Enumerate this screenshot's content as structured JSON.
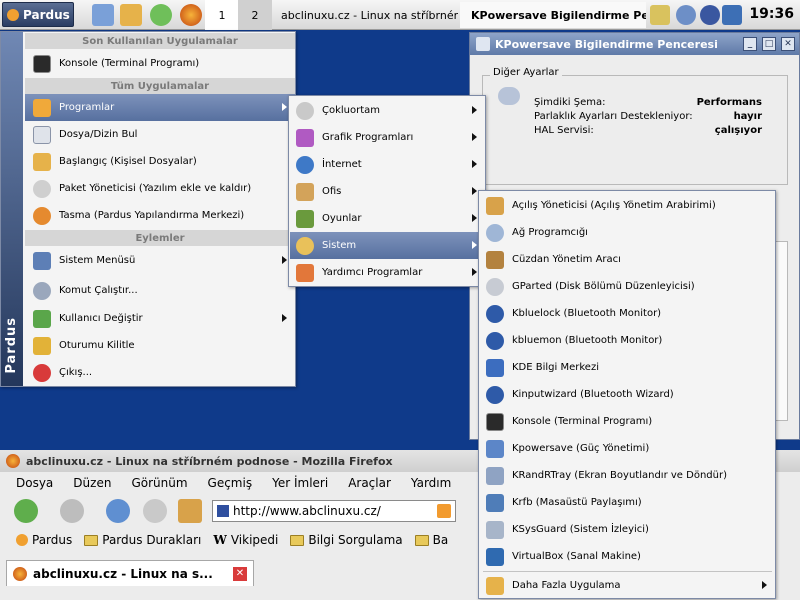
{
  "taskbar": {
    "kmenu_label": "Pardus",
    "pager": [
      "1",
      "2"
    ],
    "tasks": [
      {
        "label": "abclinuxu.cz - Linux na stříbrném"
      },
      {
        "label": "KPowersave Bigilendirme Pence"
      }
    ],
    "clock": "19:36"
  },
  "kpowersave": {
    "title": "KPowersave Bigilendirme Penceresi",
    "group_title": "Diğer Ayarlar",
    "rows": [
      {
        "label": "Şimdiki Şema:",
        "value": "Performans"
      },
      {
        "label": "Parlaklık Ayarları Destekleniyor:",
        "value": "hayır"
      },
      {
        "label": "HAL Servisi:",
        "value": "çalışıyor"
      }
    ]
  },
  "firefox": {
    "title": "abclinuxu.cz - Linux na stříbrném podnose - Mozilla Firefox",
    "menu": [
      "Dosya",
      "Düzen",
      "Görünüm",
      "Geçmiş",
      "Yer İmleri",
      "Araçlar",
      "Yardım"
    ],
    "url": "http://www.abclinuxu.cz/",
    "bookmarks": [
      "Pardus",
      "Pardus Durakları",
      "Vikipedi",
      "Bilgi Sorgulama",
      "Ba"
    ],
    "tab_label": "abclinuxu.cz - Linux na s..."
  },
  "kmenu": {
    "stripe_text": "Pardus",
    "sections": {
      "recent": "Son Kullanılan Uygulamalar",
      "all": "Tüm Uygulamalar",
      "actions": "Eylemler"
    },
    "recent": [
      {
        "label": "Konsole (Terminal Programı)"
      }
    ],
    "apps": [
      {
        "label": "Programlar"
      },
      {
        "label": "Dosya/Dizin Bul"
      },
      {
        "label": "Başlangıç (Kişisel Dosyalar)"
      },
      {
        "label": "Paket Yöneticisi (Yazılım ekle ve kaldır)"
      },
      {
        "label": "Tasma (Pardus Yapılandırma Merkezi)"
      }
    ],
    "actions": [
      {
        "label": "Sistem Menüsü"
      },
      {
        "label": "Komut Çalıştır..."
      },
      {
        "label": "Kullanıcı Değiştir"
      },
      {
        "label": "Oturumu Kilitle"
      },
      {
        "label": "Çıkış..."
      }
    ]
  },
  "programs_menu": [
    {
      "label": "Çokluortam"
    },
    {
      "label": "Grafik Programları"
    },
    {
      "label": "İnternet"
    },
    {
      "label": "Ofis"
    },
    {
      "label": "Oyunlar"
    },
    {
      "label": "Sistem"
    },
    {
      "label": "Yardımcı Programlar"
    }
  ],
  "system_menu": [
    {
      "label": "Açılış Yöneticisi (Açılış Yönetim Arabirimi)"
    },
    {
      "label": "Ağ Programcığı"
    },
    {
      "label": "Cüzdan Yönetim Aracı"
    },
    {
      "label": "GParted (Disk Bölümü Düzenleyicisi)"
    },
    {
      "label": "Kbluelock (Bluetooth Monitor)"
    },
    {
      "label": "kbluemon (Bluetooth Monitor)"
    },
    {
      "label": "KDE Bilgi Merkezi"
    },
    {
      "label": "Kinputwizard (Bluetooth Wizard)"
    },
    {
      "label": "Konsole (Terminal Programı)"
    },
    {
      "label": "Kpowersave (Güç Yönetimi)"
    },
    {
      "label": "KRandRTray (Ekran Boyutlandır ve Döndür)"
    },
    {
      "label": "Krfb (Masaüstü Paylaşımı)"
    },
    {
      "label": "KSysGuard (Sistem İzleyici)"
    },
    {
      "label": "VirtualBox (Sanal Makine)"
    },
    {
      "label": "Daha Fazla Uygulama"
    }
  ],
  "colors": {
    "menu_highlight": "#6d84b2",
    "desktop": "#0f3a8a",
    "title_bar": "#7a91bb"
  }
}
